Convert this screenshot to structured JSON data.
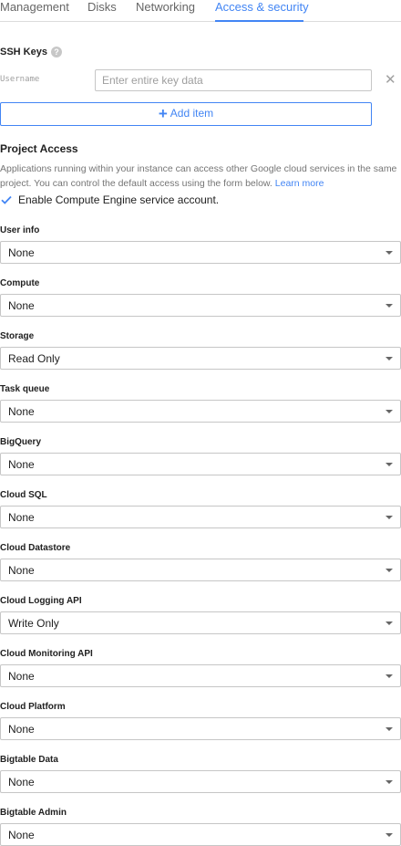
{
  "tabs": [
    {
      "label": "Management",
      "active": false
    },
    {
      "label": "Disks",
      "active": false
    },
    {
      "label": "Networking",
      "active": false
    },
    {
      "label": "Access & security",
      "active": true
    }
  ],
  "ssh": {
    "title": "SSH Keys",
    "help_icon": "?",
    "username_label": "Username",
    "key_placeholder": "Enter entire key data",
    "key_value": "",
    "remove_icon": "✕",
    "add_label": "Add item",
    "add_icon": "+"
  },
  "project_access": {
    "title": "Project Access",
    "description": "Applications running within your instance can access other Google cloud services in the same project. You can control the default access using the form below.",
    "learn_more": "Learn more",
    "checkbox_label": "Enable Compute Engine service account.",
    "checkbox_checked": true
  },
  "fields": [
    {
      "label": "User info",
      "value": "None"
    },
    {
      "label": "Compute",
      "value": "None"
    },
    {
      "label": "Storage",
      "value": "Read Only"
    },
    {
      "label": "Task queue",
      "value": "None"
    },
    {
      "label": "BigQuery",
      "value": "None"
    },
    {
      "label": "Cloud SQL",
      "value": "None"
    },
    {
      "label": "Cloud Datastore",
      "value": "None"
    },
    {
      "label": "Cloud Logging API",
      "value": "Write Only"
    },
    {
      "label": "Cloud Monitoring API",
      "value": "None"
    },
    {
      "label": "Cloud Platform",
      "value": "None"
    },
    {
      "label": "Bigtable Data",
      "value": "None"
    },
    {
      "label": "Bigtable Admin",
      "value": "None"
    }
  ],
  "colors": {
    "accent": "#4285f4",
    "border": "#c6c6c6",
    "muted_text": "#757575"
  }
}
